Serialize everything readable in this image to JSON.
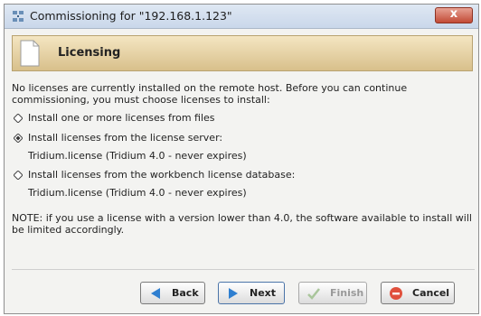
{
  "window": {
    "title": "Commissioning for \"192.168.1.123\"",
    "close_label": "x"
  },
  "header": {
    "title": "Licensing"
  },
  "content": {
    "intro": "No licenses are currently installed on the remote host. Before you can continue commissioning, you must choose licenses to install:",
    "options": [
      {
        "label": "Install one or more licenses from files",
        "selected": false,
        "detail": ""
      },
      {
        "label": "Install licenses from the license server:",
        "selected": true,
        "detail": "Tridium.license (Tridium 4.0 - never expires)"
      },
      {
        "label": "Install licenses from the workbench license database:",
        "selected": false,
        "detail": "Tridium.license (Tridium 4.0 - never expires)"
      }
    ],
    "note": "NOTE: if you use a license with a version lower than 4.0, the software available to install will be limited accordingly."
  },
  "buttons": {
    "back": "Back",
    "next": "Next",
    "finish": "Finish",
    "cancel": "Cancel"
  },
  "icons": {
    "back": "left-arrow-icon",
    "next": "right-arrow-icon",
    "finish": "check-icon",
    "cancel": "stop-icon"
  }
}
